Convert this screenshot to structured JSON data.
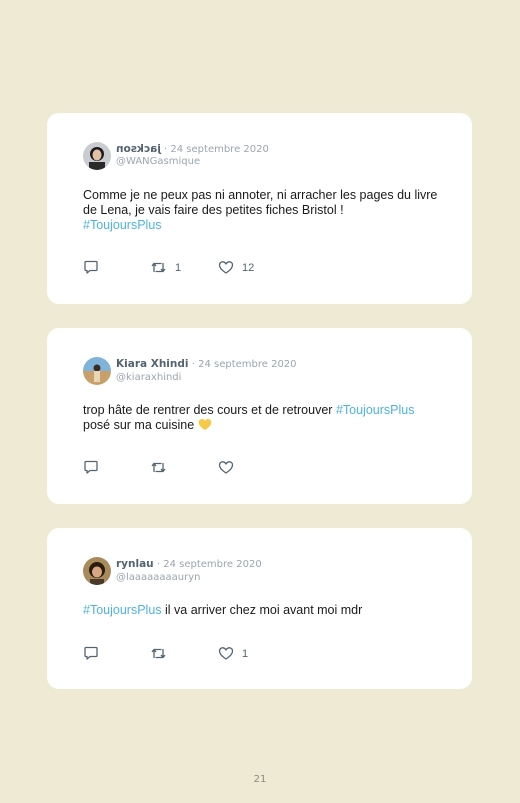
{
  "tweets": [
    {
      "name": "jackson",
      "dot": "·",
      "date": "24 septembre 2020",
      "handle": "@WANGasmique",
      "text_before": "Comme je ne peux pas ni annoter, ni arracher les pages du livre de Lena, je vais faire des petites fiches Bristol !",
      "hashtag": "#ToujoursPlus",
      "text_after": "",
      "retweets": "1",
      "likes": "12"
    },
    {
      "name": "Kiara Xhindi",
      "dot": "·",
      "date": "24 septembre 2020",
      "handle": "@kiaraxhindi",
      "text_before": "trop hâte de rentrer des cours et de retrouver",
      "hashtag": "#ToujoursPlus",
      "text_after": "posé sur ma cuisine",
      "emoji": "yellow-heart",
      "retweets": "",
      "likes": ""
    },
    {
      "name": "rynlau",
      "dot": "·",
      "date": "24 septembre 2020",
      "handle": "@laaaaaaaauryn",
      "text_before": "",
      "hashtag": "#ToujoursPlus",
      "text_after": "il va arriver chez moi avant moi mdr",
      "retweets": "",
      "likes": "1"
    }
  ],
  "page_number": "21",
  "colors": {
    "background": "#eeead4",
    "card": "#ffffff",
    "hashtag": "#4fb3e0",
    "muted": "#9aa6ae",
    "name": "#536471"
  },
  "icons": [
    "reply-icon",
    "retweet-icon",
    "like-icon",
    "yellow-heart-emoji"
  ]
}
